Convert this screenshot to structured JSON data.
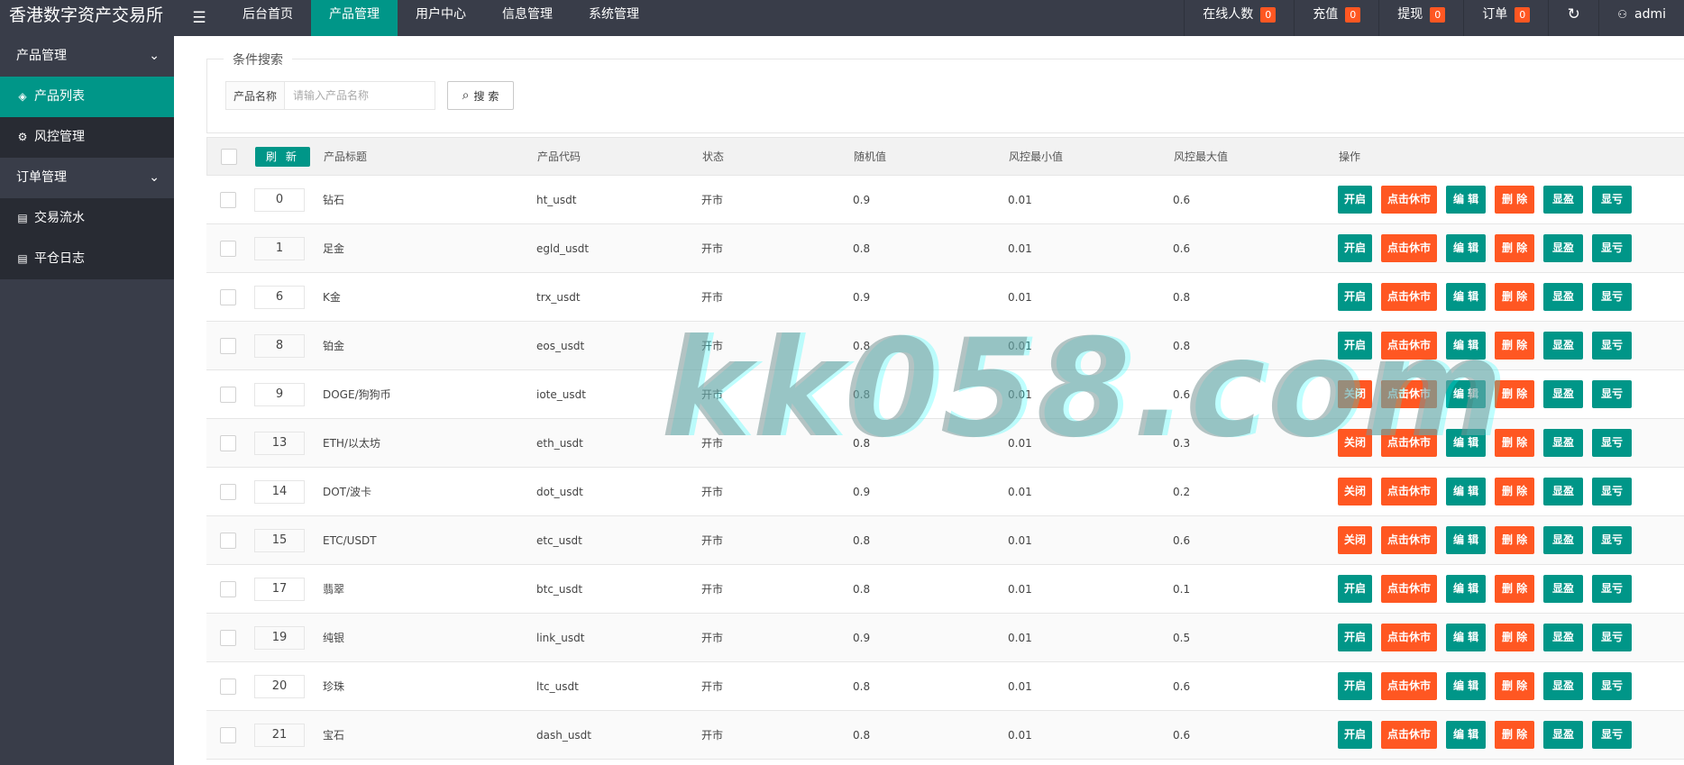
{
  "app": {
    "title": "香港数字资产交易所",
    "menu_icon": "hamburger-icon"
  },
  "topnav": [
    {
      "label": "后台首页",
      "active": false
    },
    {
      "label": "产品管理",
      "active": true
    },
    {
      "label": "用户中心",
      "active": false
    },
    {
      "label": "信息管理",
      "active": false
    },
    {
      "label": "系统管理",
      "active": false
    }
  ],
  "status": {
    "online_label": "在线人数",
    "online_count": "0",
    "recharge_label": "充值",
    "recharge_count": "0",
    "withdraw_label": "提现",
    "withdraw_count": "0",
    "order_label": "订单",
    "order_count": "0",
    "admin_label": "admi"
  },
  "sidebar": {
    "group1": "产品管理",
    "item1": "产品列表",
    "item2": "风控管理",
    "group2": "订单管理",
    "item3": "交易流水",
    "item4": "平仓日志"
  },
  "search": {
    "legend": "条件搜索",
    "label": "产品名称",
    "placeholder": "请输入产品名称",
    "button": "搜 索"
  },
  "table": {
    "refresh": "刷 新",
    "headers": {
      "title": "产品标题",
      "code": "产品代码",
      "status": "状态",
      "random": "随机值",
      "min": "风控最小值",
      "max": "风控最大值",
      "ops": "操作"
    },
    "ops": {
      "close_market": "点击休市",
      "edit": "编 辑",
      "delete": "删 除",
      "show_profit": "显盈",
      "show_loss": "显亏"
    },
    "rows": [
      {
        "sort": "0",
        "title": "钻石",
        "code": "ht_usdt",
        "status": "开市",
        "random": "0.9",
        "min": "0.01",
        "max": "0.6",
        "toggle": "开启",
        "toggle_color": "#009688"
      },
      {
        "sort": "1",
        "title": "足金",
        "code": "egld_usdt",
        "status": "开市",
        "random": "0.8",
        "min": "0.01",
        "max": "0.6",
        "toggle": "开启",
        "toggle_color": "#009688"
      },
      {
        "sort": "6",
        "title": "K金",
        "code": "trx_usdt",
        "status": "开市",
        "random": "0.9",
        "min": "0.01",
        "max": "0.8",
        "toggle": "开启",
        "toggle_color": "#009688"
      },
      {
        "sort": "8",
        "title": "铂金",
        "code": "eos_usdt",
        "status": "开市",
        "random": "0.8",
        "min": "0.01",
        "max": "0.8",
        "toggle": "开启",
        "toggle_color": "#009688"
      },
      {
        "sort": "9",
        "title": "DOGE/狗狗币",
        "code": "iote_usdt",
        "status": "开市",
        "random": "0.8",
        "min": "0.01",
        "max": "0.6",
        "toggle": "关闭",
        "toggle_color": "#ff5722"
      },
      {
        "sort": "13",
        "title": "ETH/以太坊",
        "code": "eth_usdt",
        "status": "开市",
        "random": "0.8",
        "min": "0.01",
        "max": "0.3",
        "toggle": "关闭",
        "toggle_color": "#ff5722"
      },
      {
        "sort": "14",
        "title": "DOT/波卡",
        "code": "dot_usdt",
        "status": "开市",
        "random": "0.9",
        "min": "0.01",
        "max": "0.2",
        "toggle": "关闭",
        "toggle_color": "#ff5722"
      },
      {
        "sort": "15",
        "title": "ETC/USDT",
        "code": "etc_usdt",
        "status": "开市",
        "random": "0.8",
        "min": "0.01",
        "max": "0.6",
        "toggle": "关闭",
        "toggle_color": "#ff5722"
      },
      {
        "sort": "17",
        "title": "翡翠",
        "code": "btc_usdt",
        "status": "开市",
        "random": "0.8",
        "min": "0.01",
        "max": "0.1",
        "toggle": "开启",
        "toggle_color": "#009688"
      },
      {
        "sort": "19",
        "title": "纯银",
        "code": "link_usdt",
        "status": "开市",
        "random": "0.9",
        "min": "0.01",
        "max": "0.5",
        "toggle": "开启",
        "toggle_color": "#009688"
      },
      {
        "sort": "20",
        "title": "珍珠",
        "code": "ltc_usdt",
        "status": "开市",
        "random": "0.8",
        "min": "0.01",
        "max": "0.6",
        "toggle": "开启",
        "toggle_color": "#009688"
      },
      {
        "sort": "21",
        "title": "宝石",
        "code": "dash_usdt",
        "status": "开市",
        "random": "0.8",
        "min": "0.01",
        "max": "0.6",
        "toggle": "开启",
        "toggle_color": "#009688"
      }
    ]
  },
  "watermark": "kk058.com"
}
